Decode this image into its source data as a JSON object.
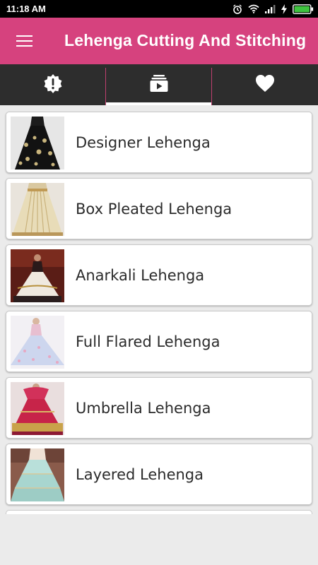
{
  "status_bar": {
    "time": "11:18 AM",
    "icons": [
      "alarm-icon",
      "wifi-icon",
      "signal-icon",
      "charging-icon",
      "battery-icon"
    ]
  },
  "app_bar": {
    "title": "Lehenga Cutting And Stitching",
    "menu_icon": "hamburger-menu-icon",
    "background_color": "#d6427e"
  },
  "tabs": [
    {
      "icon": "alert-badge-icon",
      "selected": false
    },
    {
      "icon": "video-library-icon",
      "selected": true
    },
    {
      "icon": "heart-icon",
      "selected": false
    }
  ],
  "list": {
    "items": [
      {
        "label": "Designer Lehenga",
        "image": "black-embroidered-lehenga-photo"
      },
      {
        "label": "Box Pleated Lehenga",
        "image": "cream-pleated-lehenga-photo"
      },
      {
        "label": "Anarkali Lehenga",
        "image": "bridal-anarkali-lehenga-photo"
      },
      {
        "label": "Full Flared Lehenga",
        "image": "pastel-flared-lehenga-photo"
      },
      {
        "label": "Umbrella Lehenga",
        "image": "red-umbrella-lehenga-photo"
      },
      {
        "label": "Layered Lehenga",
        "image": "mint-layered-lehenga-photo"
      }
    ]
  }
}
